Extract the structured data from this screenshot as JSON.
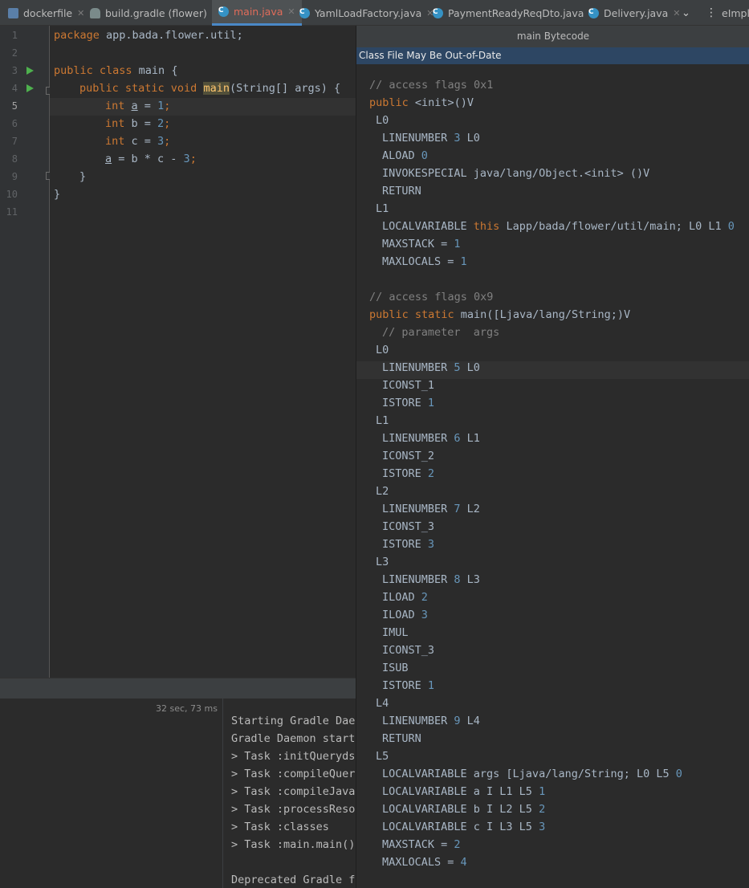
{
  "tabs": [
    {
      "label": "dockerfile",
      "icon": "docker-file-icon"
    },
    {
      "label": "build.gradle (flower)",
      "icon": "gradle-icon"
    },
    {
      "label": "main.java",
      "icon": "java-class-icon",
      "active": true
    },
    {
      "label": "YamlLoadFactory.java",
      "icon": "java-class-icon"
    },
    {
      "label": "PaymentReadyReqDto.java",
      "icon": "java-class-icon"
    },
    {
      "label": "Delivery.java",
      "icon": "java-class-icon"
    },
    {
      "label": "eImpl.",
      "icon": "overflow"
    }
  ],
  "editor": {
    "line_numbers": [
      "1",
      "2",
      "3",
      "4",
      "5",
      "6",
      "7",
      "8",
      "9",
      "10",
      "11"
    ],
    "code": {
      "l1_kw": "package",
      "l1_rest": " app.bada.flower.util;",
      "l3_kw": "public class",
      "l3_rest": " main {",
      "l4_kw": "public static void",
      "l4_fn": "main",
      "l4_rest": "(String[] args) {",
      "l5_kw": "int",
      "l5_var": "a",
      "l5_eq": " = ",
      "l5_num": "1",
      "l5_end": ";",
      "l6_kw": "int",
      "l6_mid": " b = ",
      "l6_num": "2",
      "l6_end": ";",
      "l7_kw": "int",
      "l7_mid": " c = ",
      "l7_num": "3",
      "l7_end": ";",
      "l8_var": "a",
      "l8_mid": " = b * c - ",
      "l8_num": "3",
      "l8_end": ";",
      "l9": "}",
      "l10": "}"
    }
  },
  "run": {
    "timing": "32 sec, 73 ms",
    "console_lines": [
      "Starting Gradle Daem",
      "Gradle Daemon starte",
      "> Task :initQuerydsl",
      "> Task :compileQuery",
      "> Task :compileJava",
      "> Task :processResou",
      "> Task :classes",
      "> Task :main.main()",
      "",
      "Deprecated Gradle fe"
    ]
  },
  "bytecode": {
    "title": "main Bytecode",
    "warning": "Class File May Be Out-of-Date",
    "lines": {
      "b1": "// access flags 0x1",
      "b2_kw": "public",
      "b2_rest": " <init>()V",
      "b3": "L0",
      "b4_a": "LINENUMBER ",
      "b4_n": "3",
      "b4_b": " L0",
      "b5_a": "ALOAD ",
      "b5_n": "0",
      "b6": "INVOKESPECIAL java/lang/Object.<init> ()V",
      "b7": "RETURN",
      "b8": "L1",
      "b9_a": "LOCALVARIABLE ",
      "b9_kw": "this",
      "b9_b": " Lapp/bada/flower/util/main; L0 L1 ",
      "b9_n": "0",
      "b10_a": "MAXSTACK = ",
      "b10_n": "1",
      "b11_a": "MAXLOCALS = ",
      "b11_n": "1",
      "b13": "// access flags 0x9",
      "b14_kw": "public static",
      "b14_rest": " main([Ljava/lang/String;)V",
      "b15": "// parameter  args",
      "b16": "L0",
      "b17_a": "LINENUMBER ",
      "b17_n": "5",
      "b17_b": " L0",
      "b18": "ICONST_1",
      "b19_a": "ISTORE ",
      "b19_n": "1",
      "b20": "L1",
      "b21_a": "LINENUMBER ",
      "b21_n": "6",
      "b21_b": " L1",
      "b22": "ICONST_2",
      "b23_a": "ISTORE ",
      "b23_n": "2",
      "b24": "L2",
      "b25_a": "LINENUMBER ",
      "b25_n": "7",
      "b25_b": " L2",
      "b26": "ICONST_3",
      "b27_a": "ISTORE ",
      "b27_n": "3",
      "b28": "L3",
      "b29_a": "LINENUMBER ",
      "b29_n": "8",
      "b29_b": " L3",
      "b30_a": "ILOAD ",
      "b30_n": "2",
      "b31_a": "ILOAD ",
      "b31_n": "3",
      "b32": "IMUL",
      "b33": "ICONST_3",
      "b34": "ISUB",
      "b35_a": "ISTORE ",
      "b35_n": "1",
      "b36": "L4",
      "b37_a": "LINENUMBER ",
      "b37_n": "9",
      "b37_b": " L4",
      "b38": "RETURN",
      "b39": "L5",
      "b40_a": "LOCALVARIABLE args [Ljava/lang/String; L0 L5 ",
      "b40_n": "0",
      "b41_a": "LOCALVARIABLE a I L1 L5 ",
      "b41_n": "1",
      "b42_a": "LOCALVARIABLE b I L2 L5 ",
      "b42_n": "2",
      "b43_a": "LOCALVARIABLE c I L3 L5 ",
      "b43_n": "3",
      "b44_a": "MAXSTACK = ",
      "b44_n": "2",
      "b45_a": "MAXLOCALS = ",
      "b45_n": "4"
    }
  },
  "colors": {
    "keyword": "#cc7832",
    "number": "#6897bb",
    "function": "#ffc66d",
    "comment": "#808080",
    "text": "#a9b7c6",
    "active_tab": "#e06c5a",
    "warning_bar": "#2d4663"
  }
}
